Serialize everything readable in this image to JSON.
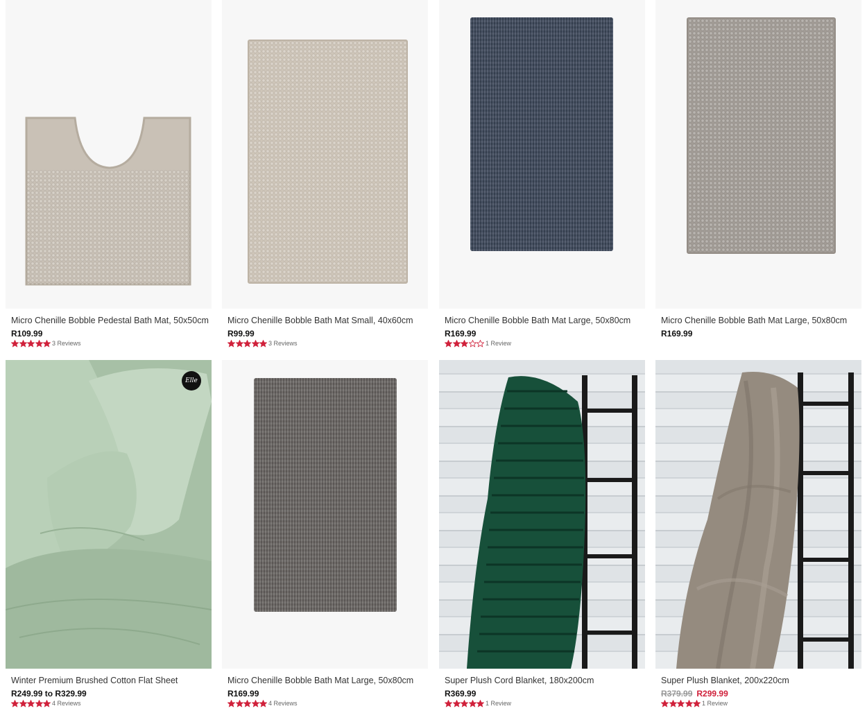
{
  "products": [
    {
      "name": "Micro Chenille Bobble Pedestal Bath Mat, 50x50cm",
      "price": "R109.99",
      "rating": 5,
      "reviews": "3 Reviews",
      "image": "pedestal-mat-beige"
    },
    {
      "name": "Micro Chenille Bobble Bath Mat Small, 40x60cm",
      "price": "R99.99",
      "rating": 5,
      "reviews": "3 Reviews",
      "image": "bath-mat-beige"
    },
    {
      "name": "Micro Chenille Bobble Bath Mat Large, 50x80cm",
      "price": "R169.99",
      "rating": 3,
      "reviews": "1 Review",
      "image": "bath-mat-navy"
    },
    {
      "name": "Micro Chenille Bobble Bath Mat Large, 50x80cm",
      "price": "R169.99",
      "rating": null,
      "reviews": "",
      "image": "bath-mat-grey"
    },
    {
      "name": "Winter Premium Brushed Cotton Flat Sheet",
      "price": "R249.99 to R329.99",
      "rating": 5,
      "reviews": "4 Reviews",
      "image": "sage-sheet",
      "badge": "Elle"
    },
    {
      "name": "Micro Chenille Bobble Bath Mat Large, 50x80cm",
      "price": "R169.99",
      "rating": 5,
      "reviews": "4 Reviews",
      "image": "bath-mat-charcoal"
    },
    {
      "name": "Super Plush Cord Blanket, 180x200cm",
      "price": "R369.99",
      "rating": 5,
      "reviews": "1 Review",
      "image": "green-cord-blanket"
    },
    {
      "name": "Super Plush Blanket, 200x220cm",
      "price_was": "R379.99",
      "price_now": "R299.99",
      "rating": 5,
      "reviews": "1 Review",
      "image": "taupe-plush-blanket"
    }
  ],
  "colors": {
    "star": "#d0213b",
    "sale": "#d0213b",
    "strike": "#999999"
  }
}
